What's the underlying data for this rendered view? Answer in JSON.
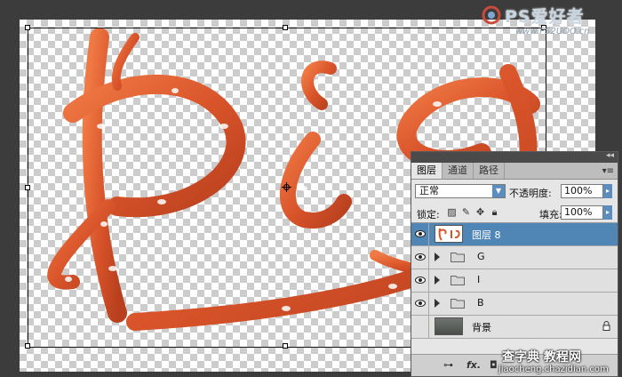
{
  "watermark": {
    "title": "PS爱好者",
    "url": "www.PS2UOO.cn"
  },
  "canvas": {
    "letters": [
      "B",
      "i",
      "G"
    ]
  },
  "layers_panel": {
    "tabs": [
      "图层",
      "通道",
      "路径"
    ],
    "active_tab": "图层",
    "tab_menu_icon": "panel-menu-icon",
    "blend_mode": "正常",
    "opacity_label": "不透明度:",
    "opacity_value": "100%",
    "lock_label": "锁定:",
    "fill_label": "填充:",
    "fill_value": "100%",
    "layers": [
      {
        "name": "图层 8",
        "visible": true,
        "selected": true,
        "type": "layer"
      },
      {
        "name": "G",
        "visible": true,
        "selected": false,
        "type": "group"
      },
      {
        "name": "I",
        "visible": true,
        "selected": false,
        "type": "group"
      },
      {
        "name": "B",
        "visible": true,
        "selected": false,
        "type": "group"
      },
      {
        "name": "背景",
        "visible": false,
        "selected": false,
        "type": "background"
      }
    ],
    "footer_icons": [
      "link-icon",
      "fx-icon",
      "mask-icon"
    ]
  },
  "credit": {
    "site": "jiaocheng.chazidian.com",
    "overlay": "查字典 教程网"
  },
  "colors": {
    "letter_orange": "#e05a2b",
    "panel_selected": "#4f86b5",
    "checker_light": "#ffffff",
    "checker_dark": "#cccccc"
  }
}
